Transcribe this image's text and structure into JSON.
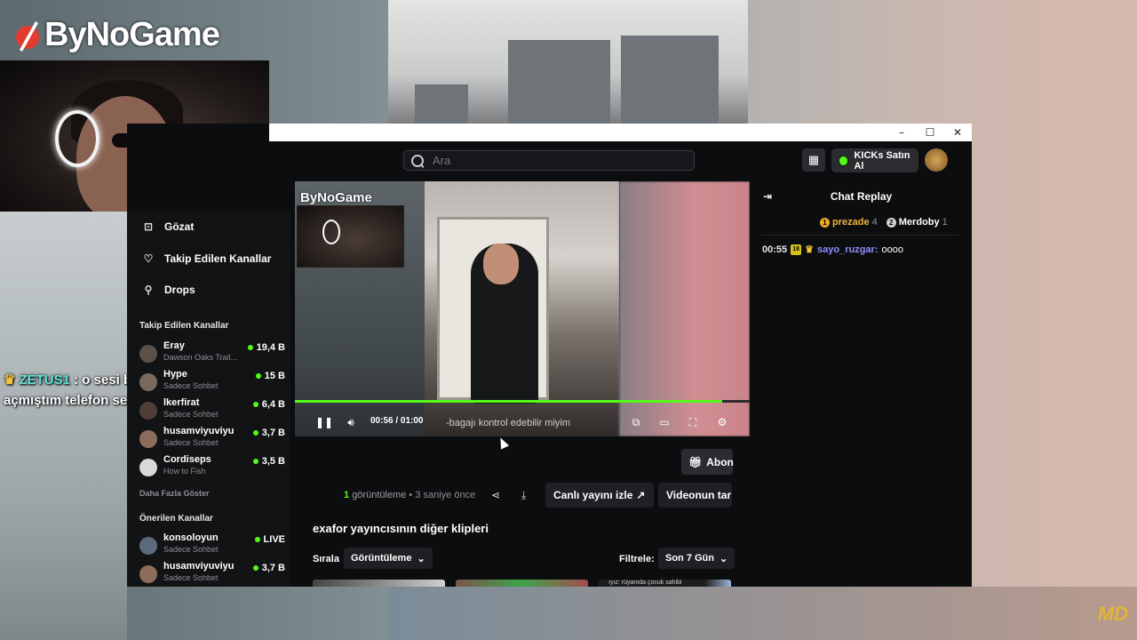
{
  "stream_overlay": {
    "brand": "ByNoGame",
    "chat_user": "ZETUS1",
    "chat_text": ": o sesi ben markette açmıştım telefon sesi fulde",
    "watermark": "MD"
  },
  "window": {
    "controls": {
      "minimize": "–",
      "maximize": "☐",
      "close": "✕"
    }
  },
  "topbar": {
    "search_placeholder": "Ara",
    "kicks_label": "KICKs Satın Al"
  },
  "sidebar": {
    "nav": [
      {
        "label": "Gözat",
        "icon": "compass-icon"
      },
      {
        "label": "Takip Edilen Kanallar",
        "icon": "heart-icon"
      },
      {
        "label": "Drops",
        "icon": "drops-icon"
      }
    ],
    "followed_title": "Takip Edilen Kanallar",
    "followed": [
      {
        "name": "Eray",
        "sub": "Dawson Oaks Trail...",
        "viewers": "19,4 B"
      },
      {
        "name": "Hype",
        "sub": "Sadece Sohbet",
        "viewers": "15 B"
      },
      {
        "name": "lkerfirat",
        "sub": "Sadece Sohbet",
        "viewers": "6,4 B"
      },
      {
        "name": "husamviyuviyu",
        "sub": "Sadece Sohbet",
        "viewers": "3,7 B"
      },
      {
        "name": "Cordiseps",
        "sub": "How to Fish",
        "viewers": "3,5 B"
      }
    ],
    "show_more": "Daha Fazla Göster",
    "recommended_title": "Önerilen Kanallar",
    "recommended": [
      {
        "name": "konsoloyun",
        "sub": "Sadece Sohbet",
        "viewers": "LIVE"
      },
      {
        "name": "husamviyuviyu",
        "sub": "Sadece Sohbet",
        "viewers": "3,7 B"
      }
    ]
  },
  "player": {
    "current_time": "00:56",
    "separator": "/",
    "duration": "01:00",
    "progress": 0.94,
    "subtitle": "-bagajı kontrol edebilir miyim",
    "cam_brand": "ByNoGame"
  },
  "actions": {
    "subscribe_label": "Abon",
    "views_count": "1",
    "views_label": "görüntüleme",
    "time_ago": "3 saniye önce",
    "watch_live": "Canlı yayını izle",
    "video_btn": "Videonun tar"
  },
  "clips": {
    "title": "exafor yayıncısının diğer klipleri",
    "sort_label": "Sırala",
    "sort_value": "Görüntüleme",
    "filter_label": "Filtrele:",
    "filter_value": "Son 7 Gün",
    "thumb_text": "ıyız: rüyamda çocuk sahibi"
  },
  "chat": {
    "title": "Chat Replay",
    "gifters": [
      {
        "rank": "1",
        "name": "prezade",
        "count": "4"
      },
      {
        "rank": "2",
        "name": "Merdoby",
        "count": "1"
      }
    ],
    "messages": [
      {
        "time": "00:55",
        "badge": "18",
        "user": "sayo_ruzgar",
        "text": "oooo"
      }
    ]
  },
  "colors": {
    "accent": "#53fc18",
    "chat_user": "#8d90ff",
    "overlay_name": "#5fe3d6"
  }
}
